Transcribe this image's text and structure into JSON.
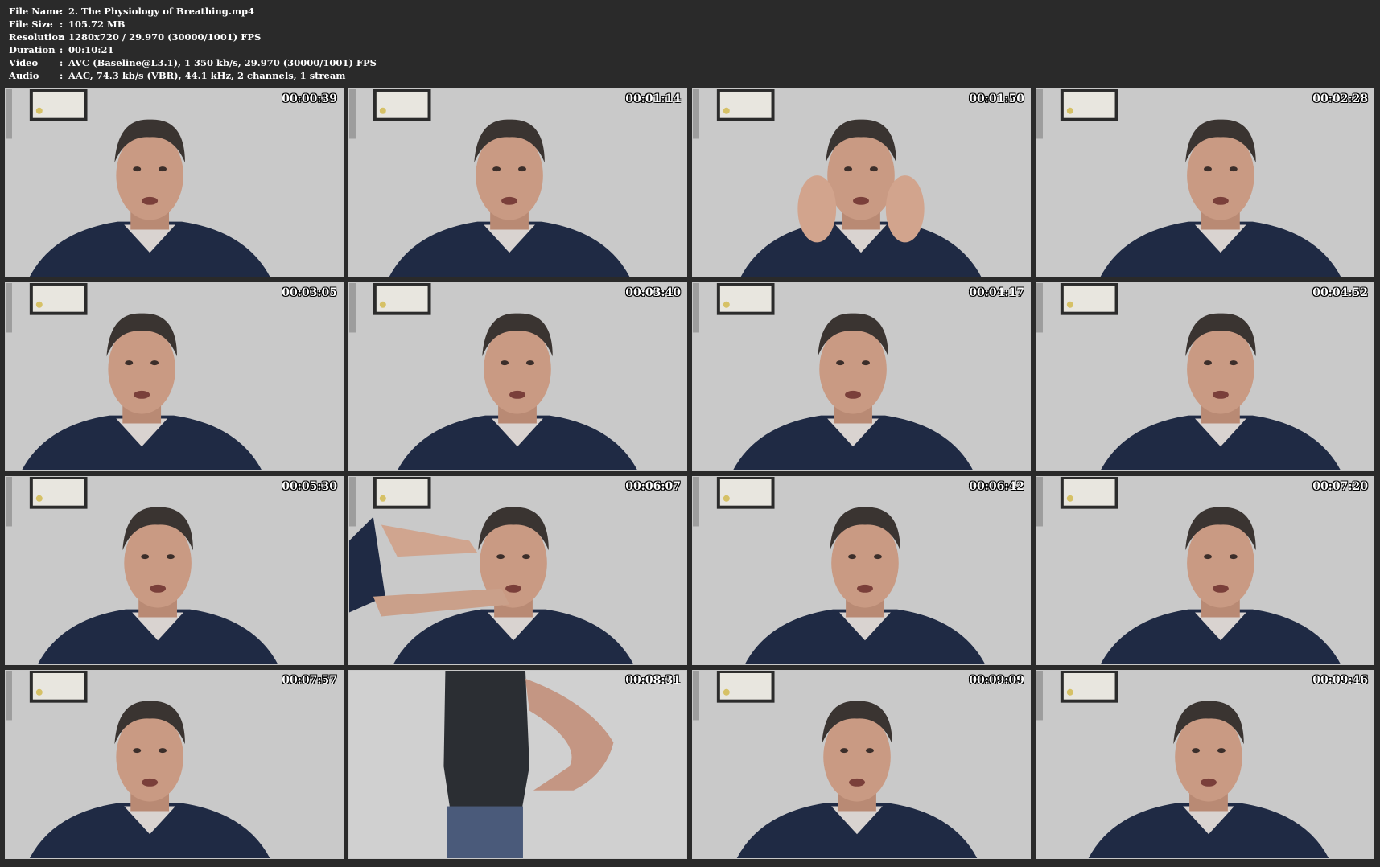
{
  "info": [
    {
      "label": "File Name",
      "separator": ":",
      "value": "2. The Physiology of Breathing.mp4"
    },
    {
      "label": "File Size",
      "separator": ":",
      "value": "105.72 MB"
    },
    {
      "label": "Resolution",
      "separator": ":",
      "value": "1280x720 / 29.970 (30000/1001) FPS"
    },
    {
      "label": "Duration",
      "separator": ":",
      "value": "00:10:21"
    },
    {
      "label": "Video",
      "separator": ":",
      "value": "AVC (Baseline@L3.1), 1 350 kb/s, 29.970 (30000/1001) FPS"
    },
    {
      "label": "Audio",
      "separator": ":",
      "value": "AAC, 74.3 kb/s (VBR), 44.1 kHz, 2 channels, 1 stream"
    }
  ],
  "thumbnails": [
    {
      "timestamp": "00:00:39",
      "scene": "speaker"
    },
    {
      "timestamp": "00:01:14",
      "scene": "speaker"
    },
    {
      "timestamp": "00:01:50",
      "scene": "speaker-hands"
    },
    {
      "timestamp": "00:02:28",
      "scene": "speaker"
    },
    {
      "timestamp": "00:03:05",
      "scene": "speaker"
    },
    {
      "timestamp": "00:03:40",
      "scene": "speaker"
    },
    {
      "timestamp": "00:04:17",
      "scene": "speaker"
    },
    {
      "timestamp": "00:04:52",
      "scene": "speaker"
    },
    {
      "timestamp": "00:05:30",
      "scene": "speaker"
    },
    {
      "timestamp": "00:06:07",
      "scene": "speaker-arm"
    },
    {
      "timestamp": "00:06:42",
      "scene": "speaker"
    },
    {
      "timestamp": "00:07:20",
      "scene": "speaker"
    },
    {
      "timestamp": "00:07:57",
      "scene": "speaker"
    },
    {
      "timestamp": "00:08:31",
      "scene": "standing-torso"
    },
    {
      "timestamp": "00:09:09",
      "scene": "speaker"
    },
    {
      "timestamp": "00:09:46",
      "scene": "speaker"
    }
  ],
  "colors": {
    "background": "#2a2a2a",
    "wall": "#c9c9c9",
    "shirt": "#1f2a44",
    "skin": "#c99a83",
    "hair": "#3a3431",
    "frame": "#2b2b2b"
  }
}
